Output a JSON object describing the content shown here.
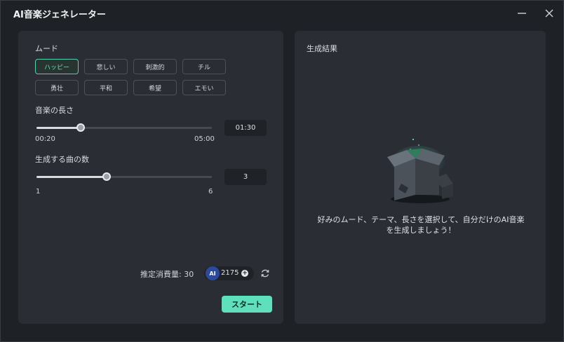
{
  "window": {
    "title": "AI音楽ジェネレーター",
    "minimize_icon": "minimize-icon",
    "close_icon": "close-icon"
  },
  "mood": {
    "label": "ムード",
    "options": [
      "ハッピー",
      "悲しい",
      "刺激的",
      "チル",
      "勇壮",
      "平和",
      "希望",
      "エモい"
    ],
    "selected": "ハッピー"
  },
  "length": {
    "label": "音楽の長さ",
    "min_label": "00:20",
    "max_label": "05:00",
    "value": "01:30",
    "min_seconds": 20,
    "max_seconds": 300,
    "value_seconds": 90
  },
  "count": {
    "label": "生成する曲の数",
    "min_label": "1",
    "max_label": "6",
    "value": "3",
    "min": 1,
    "max": 6,
    "value_num": 3
  },
  "credits": {
    "estimate_label": "推定消費量: 30",
    "ai_badge": "AI",
    "balance": "2175",
    "add_icon": "plus-circle-icon",
    "refresh_icon": "refresh-icon"
  },
  "start_label": "スタート",
  "result": {
    "title": "生成結果",
    "illustration_icon": "open-box-icon",
    "message_line1": "好みのムード、テーマ、長さを選択して、自分だけのAI音楽",
    "message_line2": "を生成しましょう！"
  },
  "colors": {
    "accent": "#5fe0bd",
    "panel": "#2a2e34",
    "background": "#1e2125"
  }
}
